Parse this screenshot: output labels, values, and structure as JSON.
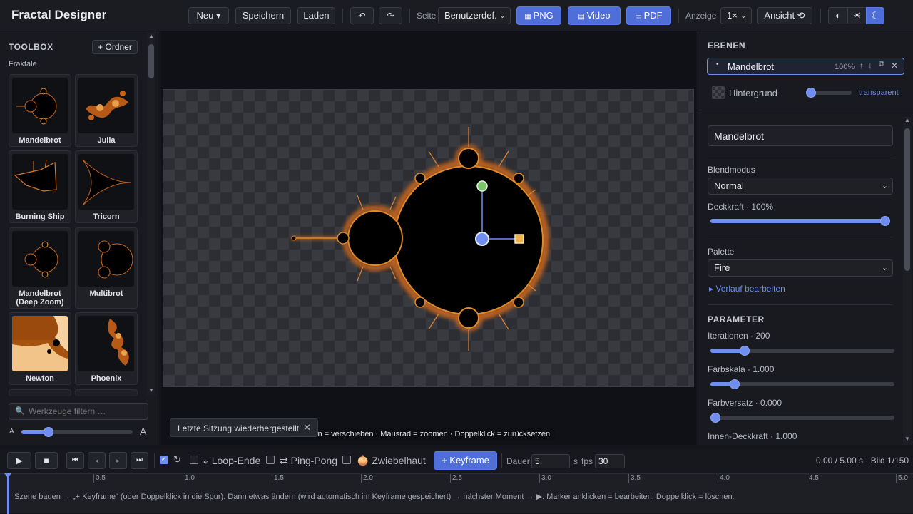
{
  "app": {
    "title": "Fractal Designer"
  },
  "toolbar": {
    "new_label": "Neu ▾",
    "save_label": "Speichern",
    "load_label": "Laden",
    "undo_icon": "undo-icon",
    "redo_icon": "redo-icon",
    "page_label": "Seite",
    "page_value": "Benutzerdef.",
    "png_label": "PNG",
    "video_label": "Video",
    "pdf_label": "PDF",
    "display_label": "Anzeige",
    "display_value": "1×",
    "view_label": "Ansicht ⟲",
    "theme_icons": [
      "contrast-icon",
      "sun-icon",
      "moon-icon"
    ],
    "accent": "#4f6ed8"
  },
  "toolbox": {
    "title": "TOOLBOX",
    "folder_button": "+ Ordner",
    "group": "Fraktale",
    "items": [
      {
        "label": "Mandelbrot"
      },
      {
        "label": "Julia"
      },
      {
        "label": "Burning Ship"
      },
      {
        "label": "Tricorn"
      },
      {
        "label": "Mandelbrot (Deep Zoom)"
      },
      {
        "label": "Multibrot"
      },
      {
        "label": "Newton"
      },
      {
        "label": "Phoenix"
      }
    ],
    "filter_placeholder": "Werkzeuge filtern …",
    "size_small": "A",
    "size_large": "A",
    "size_level": 0.22
  },
  "canvas": {
    "hint": "Ziehen = verschieben · Mausrad = zoomen · Doppelklick = zurücksetzen",
    "toast": "Letzte Sitzung wiederhergestellt"
  },
  "layers": {
    "title": "EBENEN",
    "items": [
      {
        "name": "Mandelbrot",
        "opacity": "100%"
      }
    ],
    "background_label": "Hintergrund",
    "background_value": "transparent",
    "background_level": 0
  },
  "props": {
    "name_value": "Mandelbrot",
    "blend_label": "Blendmodus",
    "blend_value": "Normal",
    "opacity_label": "Deckkraft · 100%",
    "opacity_level": 1.0,
    "palette_label": "Palette",
    "palette_value": "Fire",
    "gradient_link": "▸ Verlauf bearbeiten",
    "params_title": "PARAMETER",
    "params": [
      {
        "label": "Iterationen · 200",
        "level": 0.17
      },
      {
        "label": "Farbskala · 1.000",
        "level": 0.11
      },
      {
        "label": "Farbversatz · 0.000",
        "level": 0.0
      },
      {
        "label": "Innen-Deckkraft · 1.000",
        "level": 1.0
      }
    ]
  },
  "transport": {
    "loop_end": "⤶ Loop-Ende",
    "ping_pong": "⇄ Ping-Pong",
    "onion": "🧅 Zwiebelhaut",
    "keyframe": "+ Keyframe",
    "duration_label": "Dauer",
    "duration_value": "5",
    "duration_unit": "s",
    "fps_label": "fps",
    "fps_value": "30",
    "status": "0.00 / 5.00 s · Bild 1/150"
  },
  "timeline": {
    "ticks": [
      "0.5",
      "1.0",
      "1.5",
      "2.0",
      "2.5",
      "3.0",
      "3.5",
      "4.0",
      "4.5",
      "5.0"
    ],
    "help": "Szene bauen → „+ Keyframe“ (oder Doppelklick in die Spur). Dann etwas ändern (wird automatisch im Keyframe gespeichert) → nächster Moment → ▶. Marker anklicken = bearbeiten, Doppelklick = löschen."
  }
}
